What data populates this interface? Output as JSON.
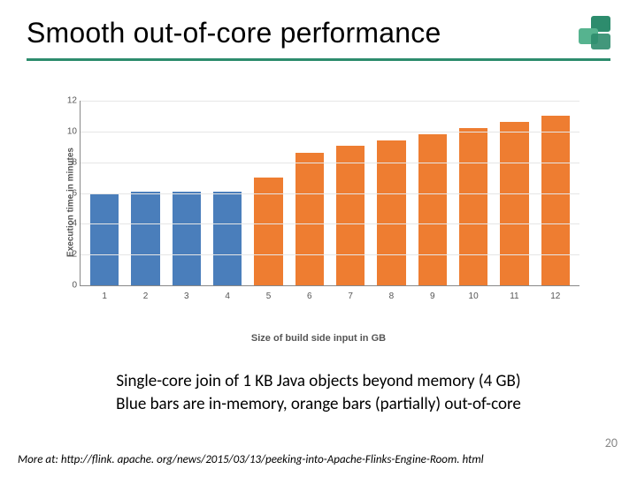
{
  "header": {
    "title": "Smooth out-of-core performance"
  },
  "chart_data": {
    "type": "bar",
    "categories": [
      "1",
      "2",
      "3",
      "4",
      "5",
      "6",
      "7",
      "8",
      "9",
      "10",
      "11",
      "12"
    ],
    "series": [
      {
        "name": "in-memory",
        "color": "#4a7ebb",
        "class": "blue",
        "mask": [
          1,
          1,
          1,
          1,
          0,
          0,
          0,
          0,
          0,
          0,
          0,
          0
        ]
      },
      {
        "name": "out-of-core",
        "color": "#ee7d31",
        "class": "orange",
        "mask": [
          0,
          0,
          0,
          0,
          1,
          1,
          1,
          1,
          1,
          1,
          1,
          1
        ]
      }
    ],
    "values": [
      6,
      6.1,
      6.1,
      6.1,
      7,
      8.6,
      9.1,
      9.4,
      9.8,
      10.2,
      10.6,
      11
    ],
    "ylabel": "Execution time in minutes",
    "xlabel": "Size of build side input in GB",
    "ylim": [
      0,
      12
    ],
    "yticks": [
      0,
      2,
      4,
      6,
      8,
      10,
      12
    ]
  },
  "caption": {
    "line1": "Single-core join of 1 KB Java objects beyond memory (4 GB)",
    "line2": "Blue bars are in-memory, orange bars (partially) out-of-core"
  },
  "footer": "More at: http://flink. apache. org/news/2015/03/13/peeking-into-Apache-Flinks-Engine-Room. html",
  "page": "20"
}
